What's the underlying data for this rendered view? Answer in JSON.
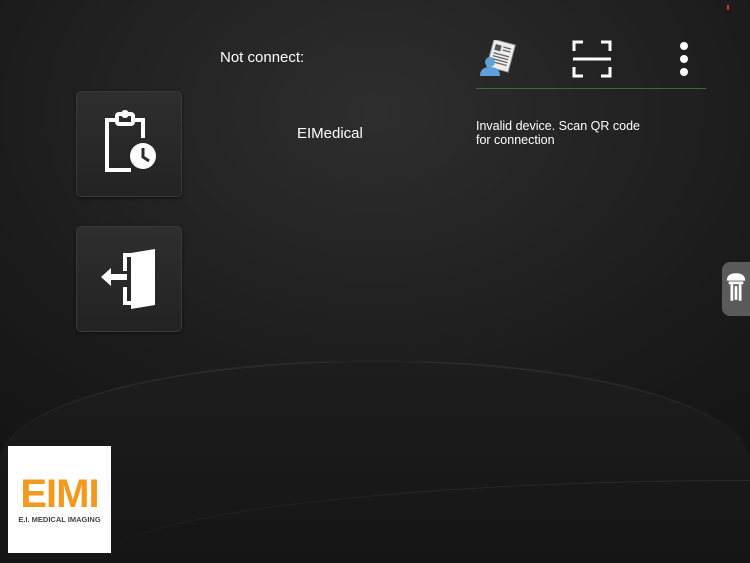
{
  "header": {
    "status": "Not connect:"
  },
  "device": {
    "name": "EIMedical",
    "message": "Invalid device. Scan QR code for connection"
  },
  "toolbar": {
    "icons": [
      "patient-record-icon",
      "qr-scan-icon",
      "more-menu-icon"
    ]
  },
  "tiles": [
    {
      "icon": "clipboard-clock-icon"
    },
    {
      "icon": "exit-door-icon"
    }
  ],
  "logo": {
    "big": "EIMI",
    "small": "E.I. MEDICAL IMAGING"
  },
  "colors": {
    "accent": "#f39a1e",
    "divider": "#3f6b2e"
  }
}
